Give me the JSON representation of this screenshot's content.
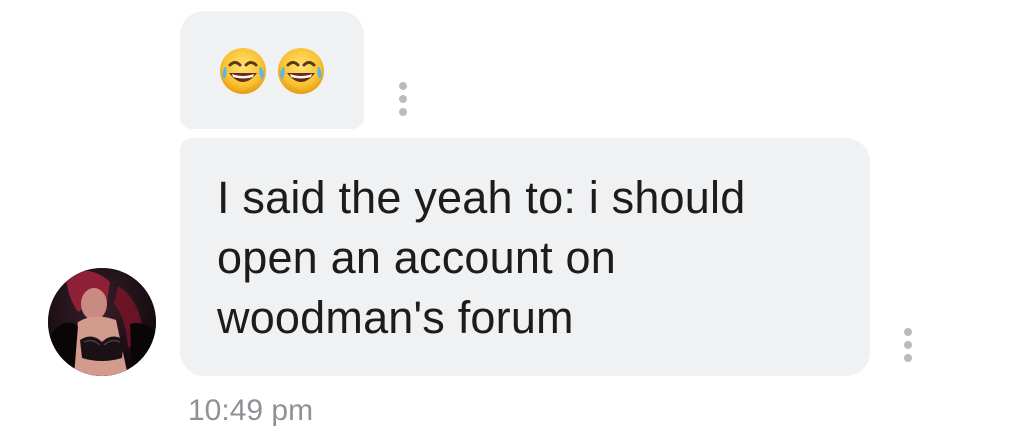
{
  "conversation": {
    "messages": [
      {
        "type": "emoji",
        "icons": [
          "face-with-tears-of-joy-icon",
          "face-with-tears-of-joy-icon"
        ]
      },
      {
        "type": "text",
        "text": "I said the yeah to: i should open an account on woodman's forum",
        "timestamp": "10:49 pm"
      }
    ]
  },
  "colors": {
    "bubble": "#f0f1f3",
    "text": "#1c1c1c",
    "timestamp": "#8e9196",
    "more_dots": "#b9bbc0"
  }
}
